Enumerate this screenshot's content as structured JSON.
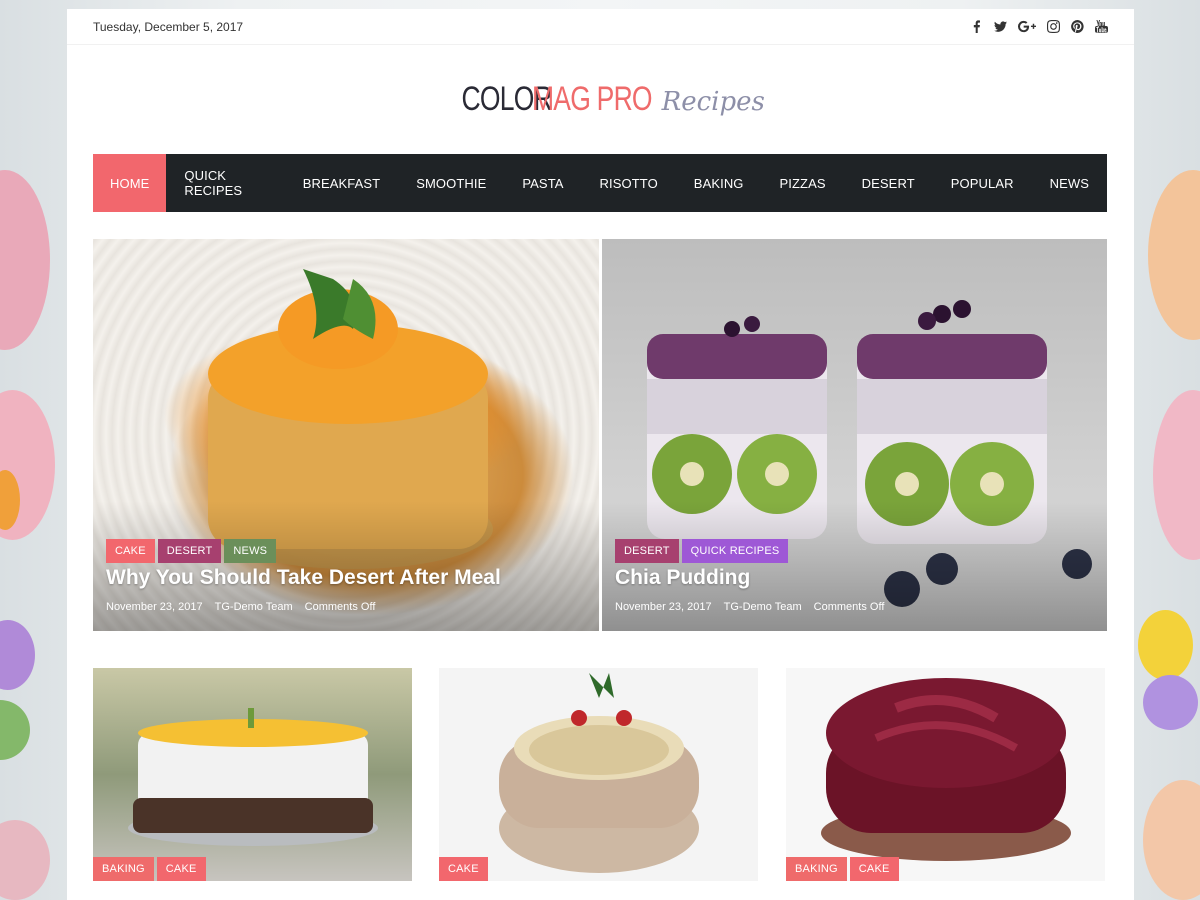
{
  "topbar": {
    "date": "Tuesday, December 5, 2017",
    "social_icons": [
      "facebook-icon",
      "twitter-icon",
      "google-plus-icon",
      "instagram-icon",
      "pinterest-icon",
      "youtube-icon"
    ]
  },
  "logo": {
    "part1": "COLOR",
    "part2": "MAG PRO",
    "part3": "Recipes"
  },
  "nav": {
    "items": [
      "HOME",
      "QUICK RECIPES",
      "BREAKFAST",
      "SMOOTHIE",
      "PASTA",
      "RISOTTO",
      "BAKING",
      "PIZZAS",
      "DESERT",
      "POPULAR",
      "NEWS"
    ],
    "active": "HOME"
  },
  "featured": [
    {
      "categories": [
        "CAKE",
        "DESERT",
        "NEWS"
      ],
      "title": "Why You Should Take Desert After Meal",
      "date": "November 23, 2017",
      "author": "TG-Demo Team",
      "comments": "Comments Off"
    },
    {
      "categories": [
        "DESERT",
        "QUICK RECIPES"
      ],
      "title": "Chia Pudding",
      "date": "November 23, 2017",
      "author": "TG-Demo Team",
      "comments": "Comments Off"
    }
  ],
  "cards": [
    {
      "categories": [
        "BAKING",
        "CAKE"
      ]
    },
    {
      "categories": [
        "CAKE"
      ]
    },
    {
      "categories": [
        "BAKING",
        "CAKE"
      ]
    }
  ],
  "colors": {
    "accent": "#f2676d",
    "nav_bg": "#1f2326",
    "desert": "#a7406f",
    "news": "#6b8f5a",
    "quick_recipes": "#9e58d6"
  }
}
